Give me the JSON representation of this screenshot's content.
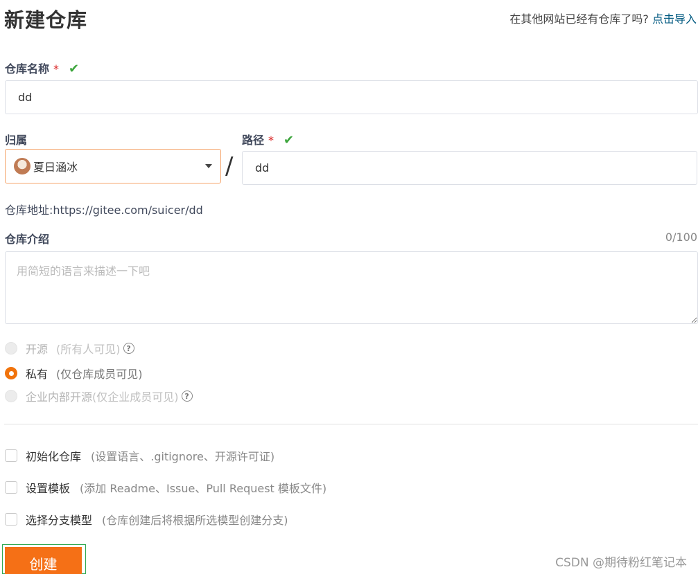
{
  "header": {
    "title": "新建仓库",
    "import_prompt": "在其他网站已经有仓库了吗?",
    "import_link": "点击导入"
  },
  "repo_name": {
    "label": "仓库名称",
    "required_mark": "*",
    "value": "dd"
  },
  "owner": {
    "label": "归属",
    "selected": "夏日涵冰",
    "separator": "/"
  },
  "path": {
    "label": "路径",
    "required_mark": "*",
    "value": "dd"
  },
  "address": {
    "label": "仓库地址:",
    "url": "https://gitee.com/suicer/dd"
  },
  "description": {
    "label": "仓库介绍",
    "counter": "0/100",
    "placeholder": "用简短的语言来描述一下吧"
  },
  "visibility": {
    "options": [
      {
        "label": "开源",
        "desc": "(所有人可见)",
        "state": "disabled",
        "help": "?"
      },
      {
        "label": "私有",
        "desc": "(仅仓库成员可见)",
        "state": "checked"
      },
      {
        "label": "企业内部开源",
        "desc": "(仅企业成员可见)",
        "state": "disabled",
        "help": "?"
      }
    ]
  },
  "options": [
    {
      "label": "初始化仓库",
      "desc": "(设置语言、.gitignore、开源许可证)",
      "checked": false
    },
    {
      "label": "设置模板",
      "desc": "(添加 Readme、Issue、Pull Request 模板文件)",
      "checked": false
    },
    {
      "label": "选择分支模型",
      "desc": "(仓库创建后将根据所选模型创建分支)",
      "checked": false
    }
  ],
  "submit": {
    "label": "创建"
  },
  "watermark": "CSDN @期待粉红笔记本",
  "colors": {
    "accent": "#f57016",
    "link": "#005980",
    "success": "#3ca53c",
    "required": "#db2828"
  }
}
